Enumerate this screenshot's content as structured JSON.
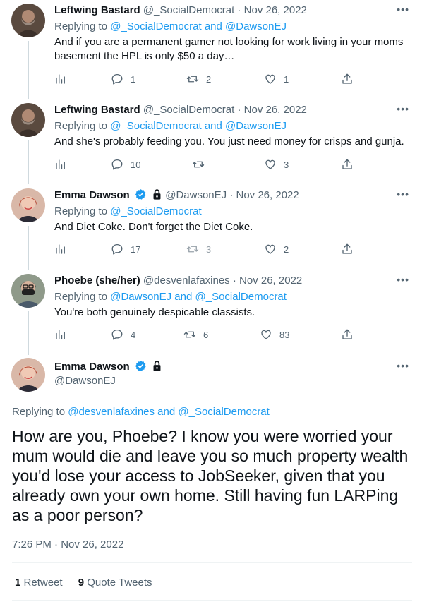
{
  "tweets": [
    {
      "name": "Leftwing Bastard",
      "handle": "@_SocialDemocrat",
      "date": "Nov 26, 2022",
      "replying_prefix": "Replying to ",
      "replying_to": "@_SocialDemocrat and @DawsonEJ",
      "text": "And if you are a permanent gamer not looking for work living in your moms basement the HPL is only $50 a day…",
      "replies": "1",
      "retweets": "2",
      "likes": "1"
    },
    {
      "name": "Leftwing Bastard",
      "handle": "@_SocialDemocrat",
      "date": "Nov 26, 2022",
      "replying_prefix": "Replying to ",
      "replying_to": "@_SocialDemocrat and @DawsonEJ",
      "text": "And she's probably feeding you. You just need money for crisps and gunja.",
      "replies": "10",
      "retweets": "",
      "likes": "3"
    },
    {
      "name": "Emma Dawson",
      "handle": "@DawsonEJ",
      "date": "Nov 26, 2022",
      "replying_prefix": "Replying to ",
      "replying_to": "@_SocialDemocrat",
      "text": "And Diet Coke. Don't forget the Diet Coke.",
      "replies": "17",
      "retweets": "3",
      "likes": "2"
    },
    {
      "name": "Phoebe (she/her)",
      "handle": "@desvenlafaxines",
      "date": "Nov 26, 2022",
      "replying_prefix": "Replying to ",
      "replying_to": "@DawsonEJ and @_SocialDemocrat",
      "text": "You're both genuinely despicable classists.",
      "replies": "4",
      "retweets": "6",
      "likes": "83"
    }
  ],
  "main": {
    "name": "Emma Dawson",
    "handle": "@DawsonEJ",
    "replying_prefix": "Replying to ",
    "replying_to": "@desvenlafaxines and @_SocialDemocrat",
    "text": "How are you, Phoebe? I know you were worried your mum would die and leave you so much property wealth you'd lose your access to JobSeeker, given that you already own your own home. Still having fun LARPing as a poor person?",
    "timestamp": "7:26 PM · Nov 26, 2022",
    "retweet_count": "1",
    "retweet_label": "Retweet",
    "quote_count": "9",
    "quote_label": "Quote Tweets"
  },
  "more_label": "•••",
  "separator": "·",
  "colors": {
    "link": "#1d9bf0",
    "verified": "#1d9bf0",
    "muted": "#536471",
    "thread": "#cfd9de"
  },
  "icons": [
    "reply-icon",
    "retweet-icon",
    "like-icon",
    "share-icon",
    "analytics-icon",
    "verified-icon",
    "lock-icon",
    "more-icon"
  ]
}
